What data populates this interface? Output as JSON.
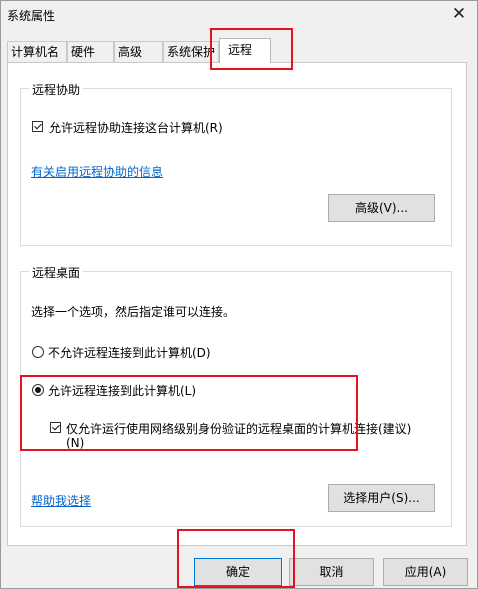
{
  "window": {
    "title": "系统属性"
  },
  "tabs": [
    {
      "label": "计算机名",
      "active": false
    },
    {
      "label": "硬件",
      "active": false
    },
    {
      "label": "高级",
      "active": false
    },
    {
      "label": "系统保护",
      "active": false
    },
    {
      "label": "远程",
      "active": true
    }
  ],
  "remote_assistance": {
    "group_title": "远程协助",
    "allow_label": "允许远程协助连接这台计算机(R)",
    "allow_checked": true,
    "info_link": "有关启用远程协助的信息",
    "advanced_button": "高级(V)..."
  },
  "remote_desktop": {
    "group_title": "远程桌面",
    "instruction": "选择一个选项，然后指定谁可以连接。",
    "option_deny": "不允许远程连接到此计算机(D)",
    "option_allow": "允许远程连接到此计算机(L)",
    "selected": "option_allow",
    "nla_label_line1": "仅允许运行使用网络级别身份验证的远程桌面的计算机连接(建议)",
    "nla_label_line2": "(N)",
    "nla_checked": true,
    "help_link": "帮助我选择",
    "select_users_button": "选择用户(S)..."
  },
  "footer": {
    "ok": "确定",
    "cancel": "取消",
    "apply": "应用(A)"
  },
  "colors": {
    "highlight": "#e81123",
    "link": "#0066cc",
    "default_button_border": "#0078d7"
  }
}
